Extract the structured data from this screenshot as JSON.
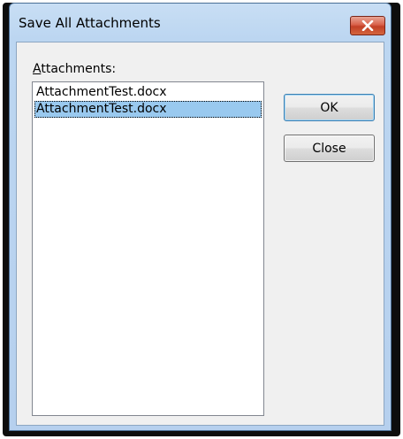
{
  "dialog": {
    "title": "Save All Attachments",
    "attachments_label_accel": "A",
    "attachments_label_rest": "ttachments:",
    "items": [
      {
        "name": "AttachmentTest.docx",
        "selected": false
      },
      {
        "name": "AttachmentTest.docx",
        "selected": true
      }
    ],
    "ok_label": "OK",
    "close_label": "Close"
  },
  "icons": {
    "close": "close-icon"
  },
  "colors": {
    "selection": "#99c9ef",
    "close_button": "#c94a30"
  }
}
